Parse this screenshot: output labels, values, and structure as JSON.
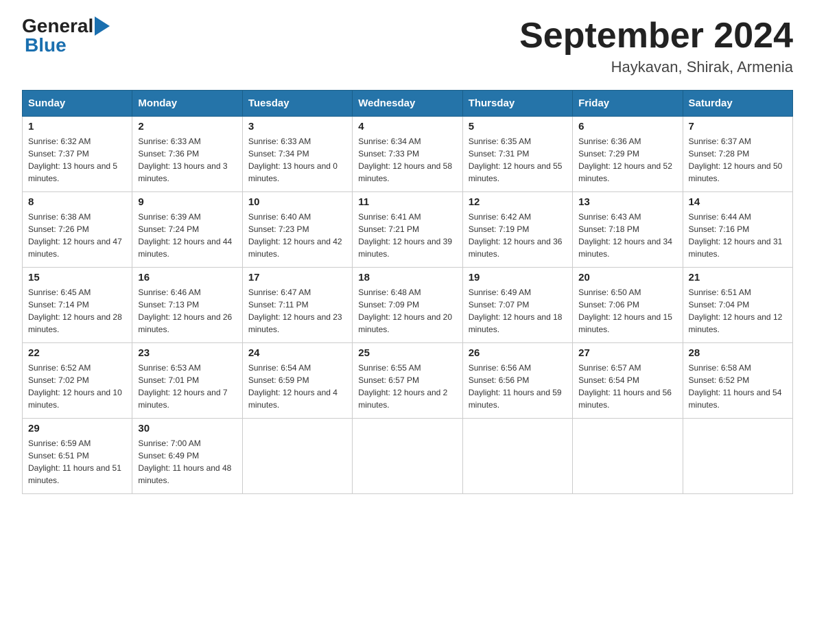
{
  "header": {
    "title": "September 2024",
    "location": "Haykavan, Shirak, Armenia",
    "logo_general": "General",
    "logo_blue": "Blue"
  },
  "columns": [
    "Sunday",
    "Monday",
    "Tuesday",
    "Wednesday",
    "Thursday",
    "Friday",
    "Saturday"
  ],
  "weeks": [
    [
      {
        "day": "1",
        "sunrise": "6:32 AM",
        "sunset": "7:37 PM",
        "daylight": "13 hours and 5 minutes."
      },
      {
        "day": "2",
        "sunrise": "6:33 AM",
        "sunset": "7:36 PM",
        "daylight": "13 hours and 3 minutes."
      },
      {
        "day": "3",
        "sunrise": "6:33 AM",
        "sunset": "7:34 PM",
        "daylight": "13 hours and 0 minutes."
      },
      {
        "day": "4",
        "sunrise": "6:34 AM",
        "sunset": "7:33 PM",
        "daylight": "12 hours and 58 minutes."
      },
      {
        "day": "5",
        "sunrise": "6:35 AM",
        "sunset": "7:31 PM",
        "daylight": "12 hours and 55 minutes."
      },
      {
        "day": "6",
        "sunrise": "6:36 AM",
        "sunset": "7:29 PM",
        "daylight": "12 hours and 52 minutes."
      },
      {
        "day": "7",
        "sunrise": "6:37 AM",
        "sunset": "7:28 PM",
        "daylight": "12 hours and 50 minutes."
      }
    ],
    [
      {
        "day": "8",
        "sunrise": "6:38 AM",
        "sunset": "7:26 PM",
        "daylight": "12 hours and 47 minutes."
      },
      {
        "day": "9",
        "sunrise": "6:39 AM",
        "sunset": "7:24 PM",
        "daylight": "12 hours and 44 minutes."
      },
      {
        "day": "10",
        "sunrise": "6:40 AM",
        "sunset": "7:23 PM",
        "daylight": "12 hours and 42 minutes."
      },
      {
        "day": "11",
        "sunrise": "6:41 AM",
        "sunset": "7:21 PM",
        "daylight": "12 hours and 39 minutes."
      },
      {
        "day": "12",
        "sunrise": "6:42 AM",
        "sunset": "7:19 PM",
        "daylight": "12 hours and 36 minutes."
      },
      {
        "day": "13",
        "sunrise": "6:43 AM",
        "sunset": "7:18 PM",
        "daylight": "12 hours and 34 minutes."
      },
      {
        "day": "14",
        "sunrise": "6:44 AM",
        "sunset": "7:16 PM",
        "daylight": "12 hours and 31 minutes."
      }
    ],
    [
      {
        "day": "15",
        "sunrise": "6:45 AM",
        "sunset": "7:14 PM",
        "daylight": "12 hours and 28 minutes."
      },
      {
        "day": "16",
        "sunrise": "6:46 AM",
        "sunset": "7:13 PM",
        "daylight": "12 hours and 26 minutes."
      },
      {
        "day": "17",
        "sunrise": "6:47 AM",
        "sunset": "7:11 PM",
        "daylight": "12 hours and 23 minutes."
      },
      {
        "day": "18",
        "sunrise": "6:48 AM",
        "sunset": "7:09 PM",
        "daylight": "12 hours and 20 minutes."
      },
      {
        "day": "19",
        "sunrise": "6:49 AM",
        "sunset": "7:07 PM",
        "daylight": "12 hours and 18 minutes."
      },
      {
        "day": "20",
        "sunrise": "6:50 AM",
        "sunset": "7:06 PM",
        "daylight": "12 hours and 15 minutes."
      },
      {
        "day": "21",
        "sunrise": "6:51 AM",
        "sunset": "7:04 PM",
        "daylight": "12 hours and 12 minutes."
      }
    ],
    [
      {
        "day": "22",
        "sunrise": "6:52 AM",
        "sunset": "7:02 PM",
        "daylight": "12 hours and 10 minutes."
      },
      {
        "day": "23",
        "sunrise": "6:53 AM",
        "sunset": "7:01 PM",
        "daylight": "12 hours and 7 minutes."
      },
      {
        "day": "24",
        "sunrise": "6:54 AM",
        "sunset": "6:59 PM",
        "daylight": "12 hours and 4 minutes."
      },
      {
        "day": "25",
        "sunrise": "6:55 AM",
        "sunset": "6:57 PM",
        "daylight": "12 hours and 2 minutes."
      },
      {
        "day": "26",
        "sunrise": "6:56 AM",
        "sunset": "6:56 PM",
        "daylight": "11 hours and 59 minutes."
      },
      {
        "day": "27",
        "sunrise": "6:57 AM",
        "sunset": "6:54 PM",
        "daylight": "11 hours and 56 minutes."
      },
      {
        "day": "28",
        "sunrise": "6:58 AM",
        "sunset": "6:52 PM",
        "daylight": "11 hours and 54 minutes."
      }
    ],
    [
      {
        "day": "29",
        "sunrise": "6:59 AM",
        "sunset": "6:51 PM",
        "daylight": "11 hours and 51 minutes."
      },
      {
        "day": "30",
        "sunrise": "7:00 AM",
        "sunset": "6:49 PM",
        "daylight": "11 hours and 48 minutes."
      },
      null,
      null,
      null,
      null,
      null
    ]
  ],
  "labels": {
    "sunrise": "Sunrise:",
    "sunset": "Sunset:",
    "daylight": "Daylight:"
  }
}
